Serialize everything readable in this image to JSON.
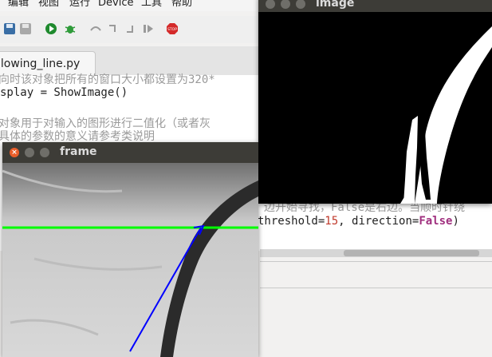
{
  "menu": [
    "编辑",
    "视图",
    "运行",
    "Device",
    "工具",
    "帮助"
  ],
  "tab": {
    "label": "llowing_line.py"
  },
  "code": {
    "line1": "向时该对象把所有的窗口大小都设置为320*",
    "line2": "splay = ShowImage()",
    "line3": "对象用于对输入的图形进行二值化（或者灰",
    "line4": "具体的参数的意义请参考类说明",
    "line5_comment": "边开始寻找，False是右边。当顺时针绕",
    "line6_prefix": " threshold=",
    "line6_num": "15",
    "line6_mid": ", direction=",
    "line6_kw": "False",
    "line6_end": ")"
  },
  "image_window": {
    "title": "image"
  },
  "frame_window": {
    "title": "frame"
  },
  "colors": {
    "green_line": "#00ff00",
    "blue_arrow": "#0000ff",
    "window_title_bg": "#3d3c37",
    "close_button": "#e95e2a"
  }
}
